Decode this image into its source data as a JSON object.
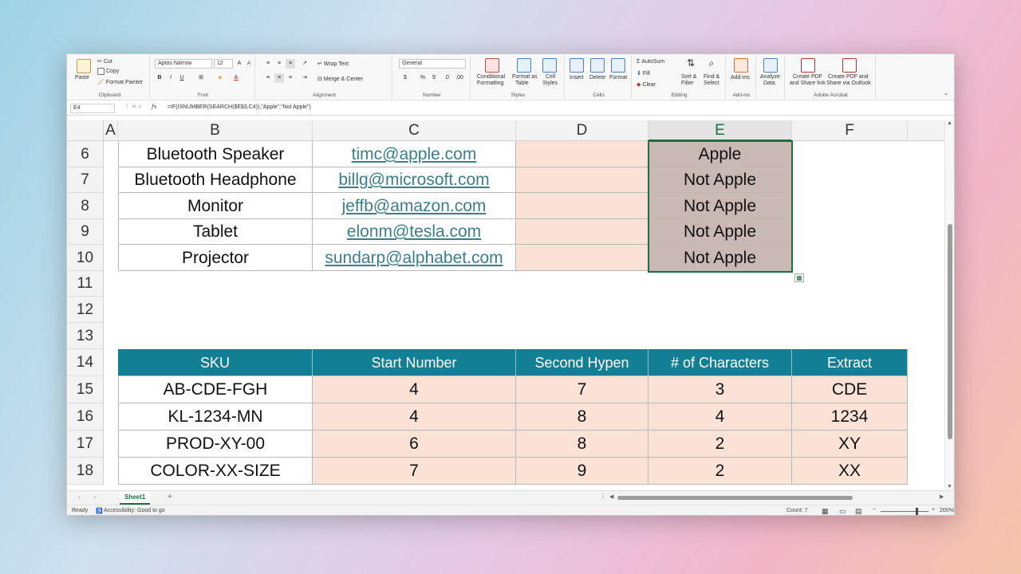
{
  "ribbon": {
    "clipboard": {
      "paste": "Paste",
      "cut": "Cut",
      "copy": "Copy",
      "format_painter": "Format Painter",
      "label": "Clipboard"
    },
    "font": {
      "name": "Aptos Narrow",
      "size": "12",
      "label": "Font",
      "bold": "B",
      "italic": "I",
      "underline": "U"
    },
    "alignment": {
      "wrap_text": "Wrap Text",
      "merge_center": "Merge & Center",
      "label": "Alignment"
    },
    "number": {
      "format": "General",
      "dollar": "$",
      "percent": "%",
      "comma": "9",
      "label": "Number"
    },
    "styles": {
      "conditional": "Conditional",
      "conditional2": "Formatting",
      "format_as": "Format as",
      "format_as2": "Table",
      "cell": "Cell",
      "cell2": "Styles",
      "label": "Styles"
    },
    "cells": {
      "insert": "Insert",
      "delete": "Delete",
      "format": "Format",
      "label": "Cells"
    },
    "editing": {
      "autosum": "AutoSum",
      "fill": "Fill",
      "clear": "Clear",
      "sort": "Sort &",
      "sort2": "Filter",
      "find": "Find &",
      "find2": "Select",
      "label": "Editing"
    },
    "addins": {
      "addins": "Add-ins",
      "label": "Add-ins"
    },
    "analyze": {
      "line1": "Analyze",
      "line2": "Data"
    },
    "acrobat": {
      "pdf1": "Create PDF",
      "pdf1b": "and Share link",
      "pdf2": "Create PDF and",
      "pdf2b": "Share via Outlook",
      "label": "Adobe Acrobat"
    }
  },
  "formula_bar": {
    "cell_ref": "E4",
    "fx": "fx",
    "formula": "=IF(ISNUMBER(SEARCH($E$3,C4)),\"Apple\",\"Not Apple\")"
  },
  "columns": [
    "A",
    "B",
    "C",
    "D",
    "E",
    "F"
  ],
  "rows": [
    "6",
    "7",
    "8",
    "9",
    "10",
    "11",
    "12",
    "13",
    "14",
    "15",
    "16",
    "17",
    "18"
  ],
  "email_table": [
    {
      "product": "Bluetooth Speaker",
      "email": "timc@apple.com",
      "result": "Apple"
    },
    {
      "product": "Bluetooth Headphone",
      "email": "billg@microsoft.com",
      "result": "Not Apple"
    },
    {
      "product": "Monitor",
      "email": "jeffb@amazon.com",
      "result": "Not Apple"
    },
    {
      "product": "Tablet",
      "email": "elonm@tesla.com",
      "result": "Not Apple"
    },
    {
      "product": "Projector",
      "email": "sundarp@alphabet.com",
      "result": "Not Apple"
    }
  ],
  "sku_table": {
    "headers": [
      "SKU",
      "Start Number",
      "Second Hypen",
      "# of Characters",
      "Extract"
    ],
    "rows": [
      [
        "AB-CDE-FGH",
        "4",
        "7",
        "3",
        "CDE"
      ],
      [
        "KL-1234-MN",
        "4",
        "8",
        "4",
        "1234"
      ],
      [
        "PROD-XY-00",
        "6",
        "8",
        "2",
        "XY"
      ],
      [
        "COLOR-XX-SIZE",
        "7",
        "9",
        "2",
        "XX"
      ]
    ]
  },
  "sheet_tab": "Sheet1",
  "status": {
    "ready": "Ready",
    "accessibility": "Accessibility: Good to go",
    "count": "Count: 7",
    "zoom": "200%"
  },
  "colors": {
    "header_teal": "#137f94",
    "peach": "#fbe2d6",
    "taupe": "#c9b8b3",
    "excel_green": "#1e6e41"
  }
}
